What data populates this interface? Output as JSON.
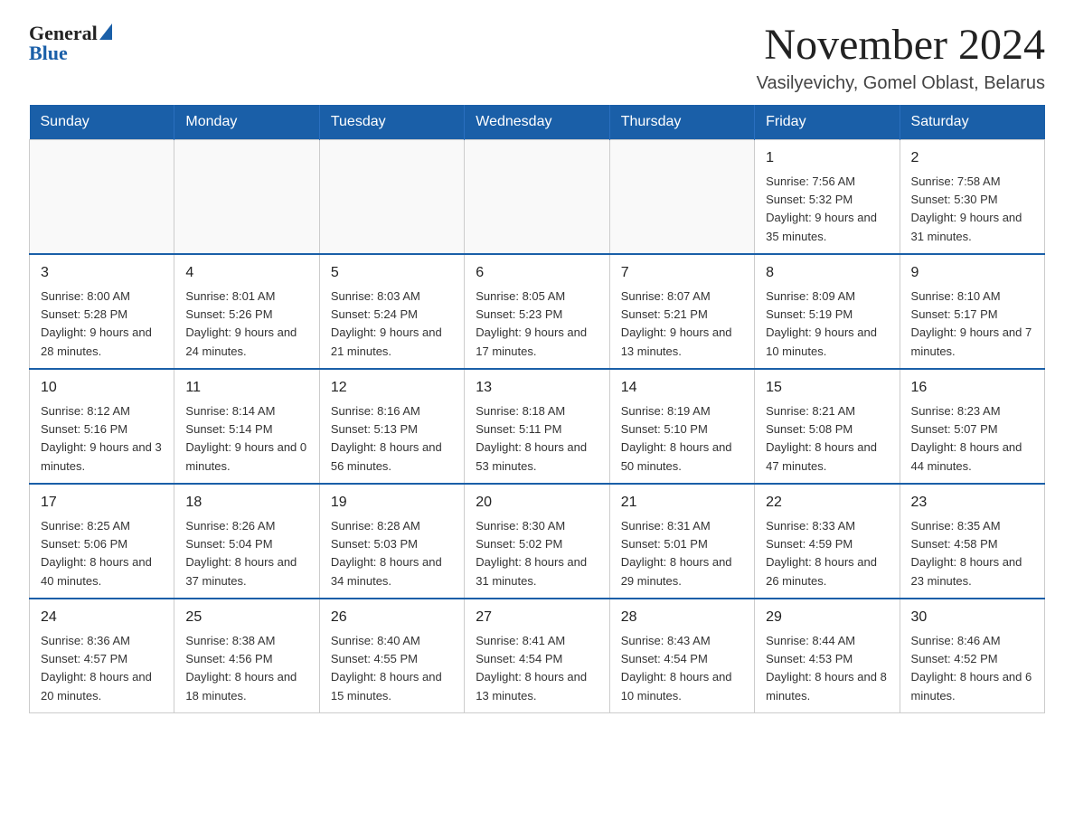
{
  "logo": {
    "general": "General",
    "blue": "Blue"
  },
  "header": {
    "month_year": "November 2024",
    "location": "Vasilyevichy, Gomel Oblast, Belarus"
  },
  "days_of_week": [
    "Sunday",
    "Monday",
    "Tuesday",
    "Wednesday",
    "Thursday",
    "Friday",
    "Saturday"
  ],
  "weeks": [
    [
      {
        "day": "",
        "sunrise": "",
        "sunset": "",
        "daylight": ""
      },
      {
        "day": "",
        "sunrise": "",
        "sunset": "",
        "daylight": ""
      },
      {
        "day": "",
        "sunrise": "",
        "sunset": "",
        "daylight": ""
      },
      {
        "day": "",
        "sunrise": "",
        "sunset": "",
        "daylight": ""
      },
      {
        "day": "",
        "sunrise": "",
        "sunset": "",
        "daylight": ""
      },
      {
        "day": "1",
        "sunrise": "Sunrise: 7:56 AM",
        "sunset": "Sunset: 5:32 PM",
        "daylight": "Daylight: 9 hours and 35 minutes."
      },
      {
        "day": "2",
        "sunrise": "Sunrise: 7:58 AM",
        "sunset": "Sunset: 5:30 PM",
        "daylight": "Daylight: 9 hours and 31 minutes."
      }
    ],
    [
      {
        "day": "3",
        "sunrise": "Sunrise: 8:00 AM",
        "sunset": "Sunset: 5:28 PM",
        "daylight": "Daylight: 9 hours and 28 minutes."
      },
      {
        "day": "4",
        "sunrise": "Sunrise: 8:01 AM",
        "sunset": "Sunset: 5:26 PM",
        "daylight": "Daylight: 9 hours and 24 minutes."
      },
      {
        "day": "5",
        "sunrise": "Sunrise: 8:03 AM",
        "sunset": "Sunset: 5:24 PM",
        "daylight": "Daylight: 9 hours and 21 minutes."
      },
      {
        "day": "6",
        "sunrise": "Sunrise: 8:05 AM",
        "sunset": "Sunset: 5:23 PM",
        "daylight": "Daylight: 9 hours and 17 minutes."
      },
      {
        "day": "7",
        "sunrise": "Sunrise: 8:07 AM",
        "sunset": "Sunset: 5:21 PM",
        "daylight": "Daylight: 9 hours and 13 minutes."
      },
      {
        "day": "8",
        "sunrise": "Sunrise: 8:09 AM",
        "sunset": "Sunset: 5:19 PM",
        "daylight": "Daylight: 9 hours and 10 minutes."
      },
      {
        "day": "9",
        "sunrise": "Sunrise: 8:10 AM",
        "sunset": "Sunset: 5:17 PM",
        "daylight": "Daylight: 9 hours and 7 minutes."
      }
    ],
    [
      {
        "day": "10",
        "sunrise": "Sunrise: 8:12 AM",
        "sunset": "Sunset: 5:16 PM",
        "daylight": "Daylight: 9 hours and 3 minutes."
      },
      {
        "day": "11",
        "sunrise": "Sunrise: 8:14 AM",
        "sunset": "Sunset: 5:14 PM",
        "daylight": "Daylight: 9 hours and 0 minutes."
      },
      {
        "day": "12",
        "sunrise": "Sunrise: 8:16 AM",
        "sunset": "Sunset: 5:13 PM",
        "daylight": "Daylight: 8 hours and 56 minutes."
      },
      {
        "day": "13",
        "sunrise": "Sunrise: 8:18 AM",
        "sunset": "Sunset: 5:11 PM",
        "daylight": "Daylight: 8 hours and 53 minutes."
      },
      {
        "day": "14",
        "sunrise": "Sunrise: 8:19 AM",
        "sunset": "Sunset: 5:10 PM",
        "daylight": "Daylight: 8 hours and 50 minutes."
      },
      {
        "day": "15",
        "sunrise": "Sunrise: 8:21 AM",
        "sunset": "Sunset: 5:08 PM",
        "daylight": "Daylight: 8 hours and 47 minutes."
      },
      {
        "day": "16",
        "sunrise": "Sunrise: 8:23 AM",
        "sunset": "Sunset: 5:07 PM",
        "daylight": "Daylight: 8 hours and 44 minutes."
      }
    ],
    [
      {
        "day": "17",
        "sunrise": "Sunrise: 8:25 AM",
        "sunset": "Sunset: 5:06 PM",
        "daylight": "Daylight: 8 hours and 40 minutes."
      },
      {
        "day": "18",
        "sunrise": "Sunrise: 8:26 AM",
        "sunset": "Sunset: 5:04 PM",
        "daylight": "Daylight: 8 hours and 37 minutes."
      },
      {
        "day": "19",
        "sunrise": "Sunrise: 8:28 AM",
        "sunset": "Sunset: 5:03 PM",
        "daylight": "Daylight: 8 hours and 34 minutes."
      },
      {
        "day": "20",
        "sunrise": "Sunrise: 8:30 AM",
        "sunset": "Sunset: 5:02 PM",
        "daylight": "Daylight: 8 hours and 31 minutes."
      },
      {
        "day": "21",
        "sunrise": "Sunrise: 8:31 AM",
        "sunset": "Sunset: 5:01 PM",
        "daylight": "Daylight: 8 hours and 29 minutes."
      },
      {
        "day": "22",
        "sunrise": "Sunrise: 8:33 AM",
        "sunset": "Sunset: 4:59 PM",
        "daylight": "Daylight: 8 hours and 26 minutes."
      },
      {
        "day": "23",
        "sunrise": "Sunrise: 8:35 AM",
        "sunset": "Sunset: 4:58 PM",
        "daylight": "Daylight: 8 hours and 23 minutes."
      }
    ],
    [
      {
        "day": "24",
        "sunrise": "Sunrise: 8:36 AM",
        "sunset": "Sunset: 4:57 PM",
        "daylight": "Daylight: 8 hours and 20 minutes."
      },
      {
        "day": "25",
        "sunrise": "Sunrise: 8:38 AM",
        "sunset": "Sunset: 4:56 PM",
        "daylight": "Daylight: 8 hours and 18 minutes."
      },
      {
        "day": "26",
        "sunrise": "Sunrise: 8:40 AM",
        "sunset": "Sunset: 4:55 PM",
        "daylight": "Daylight: 8 hours and 15 minutes."
      },
      {
        "day": "27",
        "sunrise": "Sunrise: 8:41 AM",
        "sunset": "Sunset: 4:54 PM",
        "daylight": "Daylight: 8 hours and 13 minutes."
      },
      {
        "day": "28",
        "sunrise": "Sunrise: 8:43 AM",
        "sunset": "Sunset: 4:54 PM",
        "daylight": "Daylight: 8 hours and 10 minutes."
      },
      {
        "day": "29",
        "sunrise": "Sunrise: 8:44 AM",
        "sunset": "Sunset: 4:53 PM",
        "daylight": "Daylight: 8 hours and 8 minutes."
      },
      {
        "day": "30",
        "sunrise": "Sunrise: 8:46 AM",
        "sunset": "Sunset: 4:52 PM",
        "daylight": "Daylight: 8 hours and 6 minutes."
      }
    ]
  ]
}
